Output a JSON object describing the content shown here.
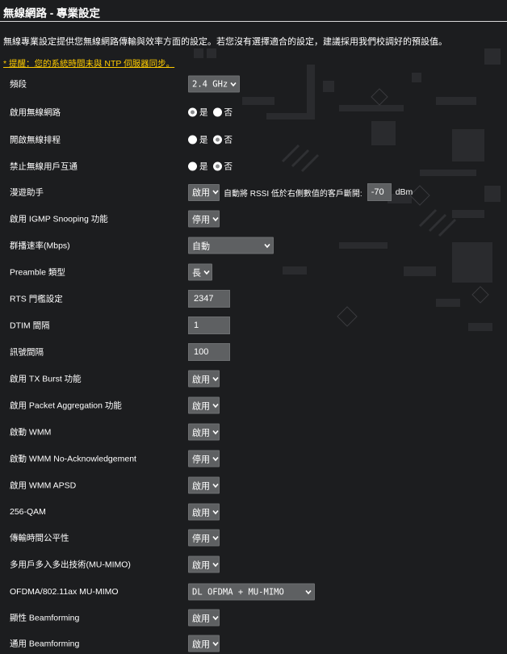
{
  "title": "無線網路 - 專業設定",
  "description": "無線專業設定提供您無線網路傳輸與效率方面的設定。若您沒有選擇適合的設定，建議採用我們校調好的預設值。",
  "notice": "* 提醒：您的系統時間未與 NTP 伺服器同步。",
  "rows": {
    "band": {
      "label": "頻段",
      "value": "2.4 GHz"
    },
    "enable_radio": {
      "label": "啟用無線網路",
      "yes": "是",
      "no": "否",
      "selected": "yes"
    },
    "wireless_schedule": {
      "label": "開啟無線排程",
      "yes": "是",
      "no": "否",
      "selected": "no"
    },
    "ap_isolation": {
      "label": "禁止無線用戶互通",
      "yes": "是",
      "no": "否",
      "selected": "no"
    },
    "roaming": {
      "label": "漫遊助手",
      "value": "啟用",
      "hint": "自動將 RSSI 低於右側數值的客戶斷開:",
      "rssi": "-70",
      "unit": "dBm"
    },
    "igmp": {
      "label": "啟用 IGMP Snooping 功能",
      "value": "停用"
    },
    "multicast_rate": {
      "label": "群播速率(Mbps)",
      "value": "自動"
    },
    "preamble": {
      "label": "Preamble 類型",
      "value": "長"
    },
    "rts": {
      "label": "RTS 門檻設定",
      "value": "2347"
    },
    "dtim": {
      "label": "DTIM 間隔",
      "value": "1"
    },
    "beacon": {
      "label": "訊號間隔",
      "value": "100"
    },
    "tx_burst": {
      "label": "啟用 TX Burst 功能",
      "value": "啟用"
    },
    "packet_agg": {
      "label": "啟用 Packet Aggregation 功能",
      "value": "啟用"
    },
    "wmm": {
      "label": "啟動 WMM",
      "value": "啟用"
    },
    "wmm_noack": {
      "label": "啟動 WMM No-Acknowledgement",
      "value": "停用"
    },
    "wmm_apsd": {
      "label": "啟用 WMM APSD",
      "value": "啟用"
    },
    "qam256": {
      "label": "256-QAM",
      "value": "啟用"
    },
    "airtime": {
      "label": "傳輸時間公平性",
      "value": "停用"
    },
    "mumimo": {
      "label": "多用戶多入多出技術(MU-MIMO)",
      "value": "啟用"
    },
    "ofdma": {
      "label": "OFDMA/802.11ax MU-MIMO",
      "value": "DL OFDMA + MU-MIMO"
    },
    "explicit_bf": {
      "label": "顯性 Beamforming",
      "value": "啟用"
    },
    "universal_bf": {
      "label": "通用 Beamforming",
      "value": "啟用"
    }
  },
  "colors": {
    "background": "#1c1d1f",
    "control": "#5e6062",
    "notice": "#ffcc00"
  },
  "icons": {
    "dropdown": "chevron-down-icon",
    "radio_on": "radio-selected-icon",
    "radio_off": "radio-unselected-icon"
  }
}
